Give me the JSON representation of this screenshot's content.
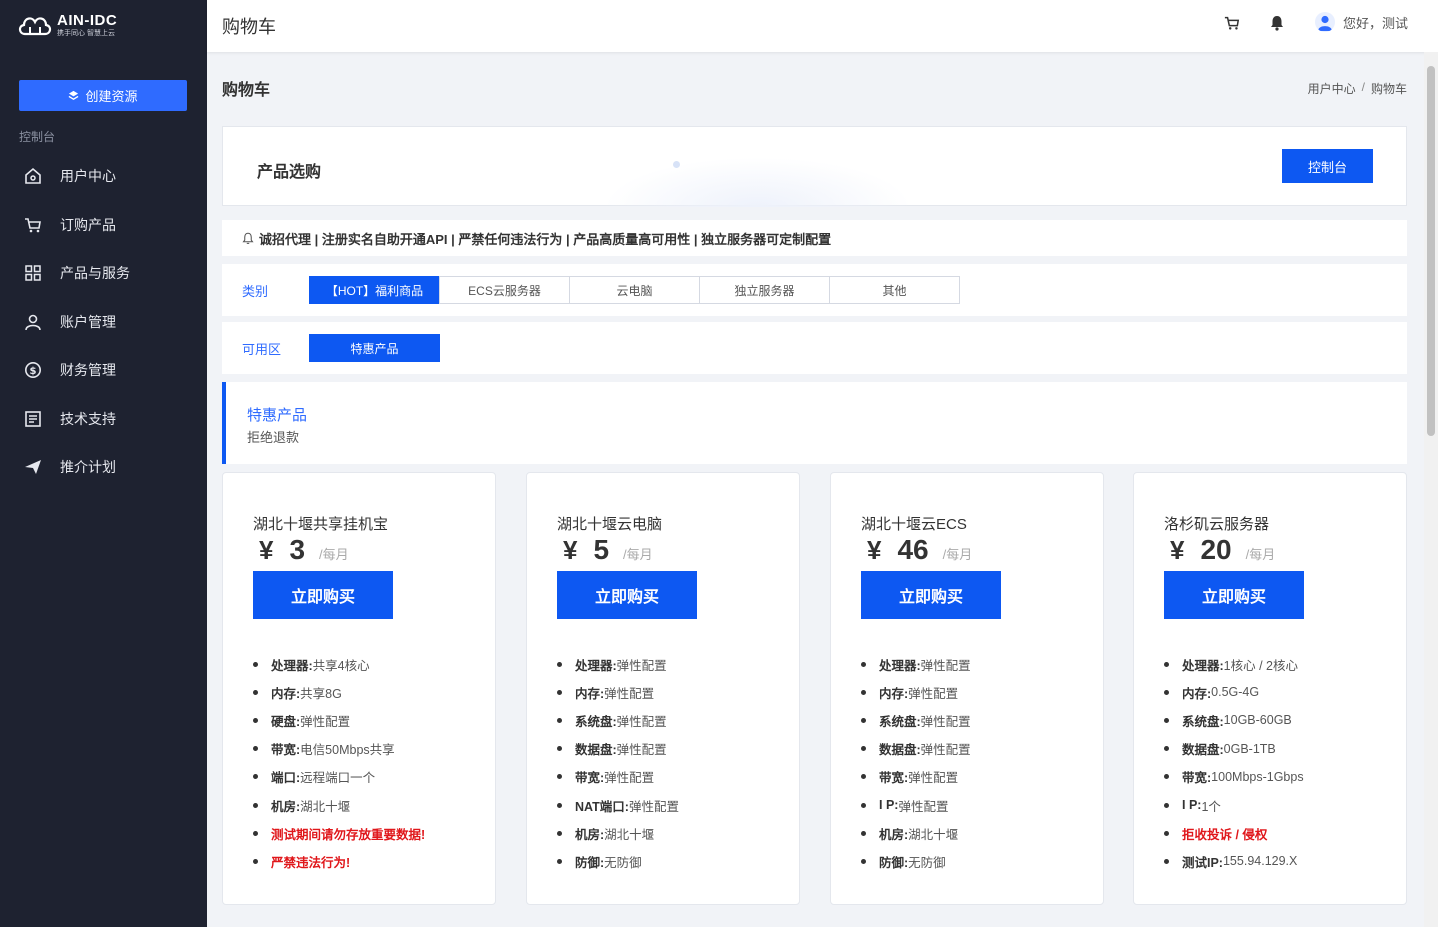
{
  "brand": {
    "title": "AIN-IDC",
    "subtitle": "携手同心 智慧上云"
  },
  "sidebar": {
    "create_label": "创建资源",
    "section_label": "控制台",
    "items": [
      {
        "label": "用户中心",
        "icon": "home-icon"
      },
      {
        "label": "订购产品",
        "icon": "cart-icon"
      },
      {
        "label": "产品与服务",
        "icon": "grid-icon"
      },
      {
        "label": "账户管理",
        "icon": "user-icon"
      },
      {
        "label": "财务管理",
        "icon": "dollar-icon"
      },
      {
        "label": "技术支持",
        "icon": "document-icon"
      },
      {
        "label": "推介计划",
        "icon": "send-icon"
      }
    ]
  },
  "topbar": {
    "title": "购物车",
    "greeting": "您好，测试"
  },
  "page": {
    "heading": "购物车",
    "breadcrumb": [
      "用户中心",
      "购物车"
    ],
    "panel_title": "产品选购",
    "console_label": "控制台",
    "notice": "诚招代理 | 注册实名自助开通API | 严禁任何违法行为 | 产品高质量高可用性 | 独立服务器可定制配置"
  },
  "filters": {
    "category_label": "类别",
    "categories": [
      "【HOT】福利商品",
      "ECS云服务器",
      "云电脑",
      "独立服务器",
      "其他"
    ],
    "active_category": 0,
    "zone_label": "可用区",
    "zones": [
      "特惠产品"
    ],
    "active_zone": 0
  },
  "zone": {
    "title": "特惠产品",
    "desc": "拒绝退款"
  },
  "products": [
    {
      "name": "湖北十堰共享挂机宝",
      "currency": "¥",
      "price": "3",
      "unit": "/每月",
      "buy_label": "立即购买",
      "specs": [
        {
          "k": "处理器:",
          "v": "共享4核心"
        },
        {
          "k": "内存:",
          "v": "共享8G"
        },
        {
          "k": "硬盘:",
          "v": "弹性配置"
        },
        {
          "k": "带宽:",
          "v": "电信50Mbps共享"
        },
        {
          "k": "端口:",
          "v": "远程端口一个"
        },
        {
          "k": "机房:",
          "v": "湖北十堰"
        },
        {
          "warn": "测试期间请勿存放重要数据!"
        },
        {
          "warn": "严禁违法行为!"
        }
      ]
    },
    {
      "name": "湖北十堰云电脑",
      "currency": "¥",
      "price": "5",
      "unit": "/每月",
      "buy_label": "立即购买",
      "specs": [
        {
          "k": "处理器:",
          "v": "弹性配置"
        },
        {
          "k": "内存:",
          "v": "弹性配置"
        },
        {
          "k": "系统盘:",
          "v": "弹性配置"
        },
        {
          "k": "数据盘:",
          "v": "弹性配置"
        },
        {
          "k": "带宽:",
          "v": "弹性配置"
        },
        {
          "k": "NAT端口:",
          "v": "弹性配置"
        },
        {
          "k": "机房:",
          "v": "湖北十堰"
        },
        {
          "k": "防御:",
          "v": "无防御"
        }
      ]
    },
    {
      "name": "湖北十堰云ECS",
      "currency": "¥",
      "price": "46",
      "unit": "/每月",
      "buy_label": "立即购买",
      "specs": [
        {
          "k": "处理器:",
          "v": "弹性配置"
        },
        {
          "k": "内存:",
          "v": "弹性配置"
        },
        {
          "k": "系统盘:",
          "v": "弹性配置"
        },
        {
          "k": "数据盘:",
          "v": "弹性配置"
        },
        {
          "k": "带宽:",
          "v": "弹性配置"
        },
        {
          "k": "I P:",
          "v": "弹性配置"
        },
        {
          "k": "机房:",
          "v": "湖北十堰"
        },
        {
          "k": "防御:",
          "v": "无防御"
        }
      ]
    },
    {
      "name": "洛杉矶云服务器",
      "currency": "¥",
      "price": "20",
      "unit": "/每月",
      "buy_label": "立即购买",
      "specs": [
        {
          "k": "处理器:",
          "v": "1核心 / 2核心"
        },
        {
          "k": "内存:",
          "v": "0.5G-4G"
        },
        {
          "k": "系统盘:",
          "v": "10GB-60GB"
        },
        {
          "k": "数据盘:",
          "v": "0GB-1TB"
        },
        {
          "k": "带宽:",
          "v": "100Mbps-1Gbps"
        },
        {
          "k": "I P:",
          "v": "1个"
        },
        {
          "warn": "拒收投诉 / 侵权"
        },
        {
          "k": "测试IP:",
          "v": "155.94.129.X"
        }
      ]
    }
  ],
  "colors": {
    "primary": "#0d58f2",
    "sidebar_bg": "#1e2230",
    "accent_text": "#2f6bff",
    "warn": "#e0171b"
  }
}
